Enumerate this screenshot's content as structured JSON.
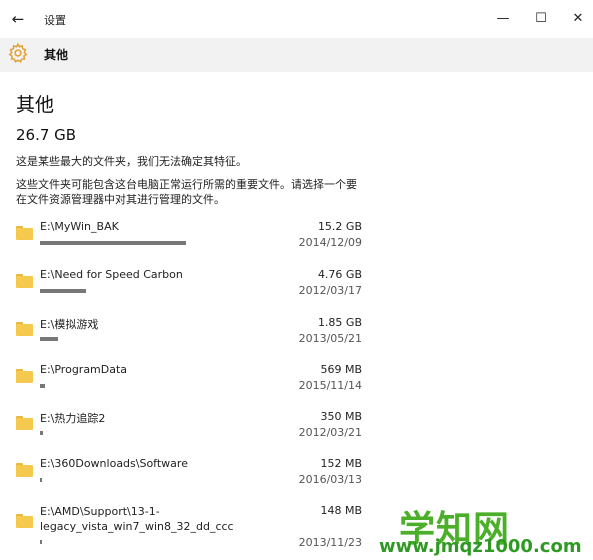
{
  "titlebar": {
    "back_glyph": "←",
    "title": "设置",
    "min_glyph": "—",
    "max_glyph": "☐",
    "close_glyph": "✕"
  },
  "header": {
    "icon": "gear-icon",
    "title": "其他",
    "accent_color": "#e0a030"
  },
  "main": {
    "section_title": "其他",
    "total_size": "26.7 GB",
    "description_1": "这是某些最大的文件夹，我们无法确定其特征。",
    "description_2": "这些文件夹可能包含这台电脑正常运行所需的重要文件。请选择一个要在文件资源管理器中对其进行管理的文件。"
  },
  "folders": [
    {
      "path": "E:\\MyWin_BAK",
      "size": "15.2 GB",
      "date": "2014/12/09",
      "usage_fraction": 1.0
    },
    {
      "path": "E:\\Need for Speed Carbon",
      "size": "4.76 GB",
      "date": "2012/03/17",
      "usage_fraction": 0.313
    },
    {
      "path": "E:\\模拟游戏",
      "size": "1.85 GB",
      "date": "2013/05/21",
      "usage_fraction": 0.122
    },
    {
      "path": "E:\\ProgramData",
      "size": "569 MB",
      "date": "2015/11/14",
      "usage_fraction": 0.037
    },
    {
      "path": "E:\\热力追踪2",
      "size": "350 MB",
      "date": "2012/03/21",
      "usage_fraction": 0.023
    },
    {
      "path": "E:\\360Downloads\\Software",
      "size": "152 MB",
      "date": "2016/03/13",
      "usage_fraction": 0.01
    },
    {
      "path": "E:\\AMD\\Support\\13-1-legacy_vista_win7_win8_32_dd_ccc",
      "size": "148 MB",
      "date": "2013/11/23",
      "usage_fraction": 0.01
    }
  ],
  "watermark": {
    "logo": "学知网",
    "url": "www.jmqz1000.com"
  }
}
